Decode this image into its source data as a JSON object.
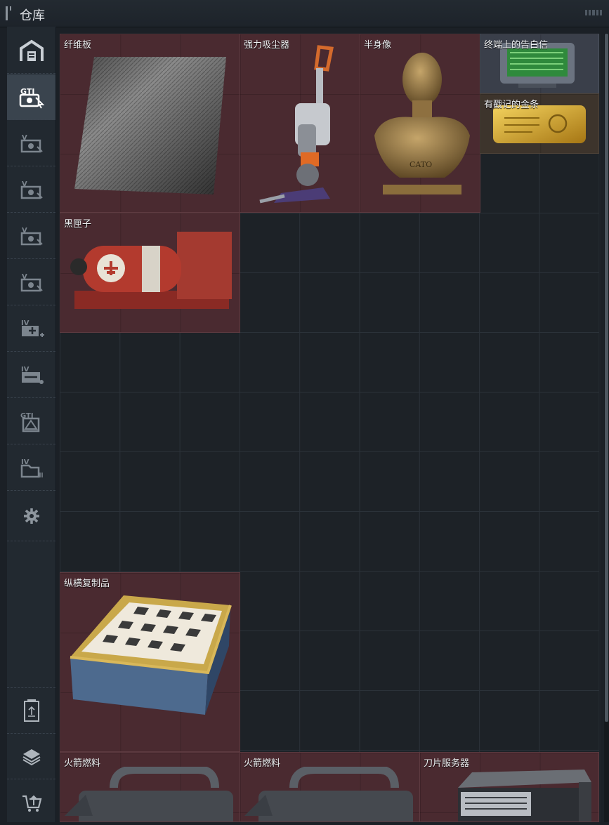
{
  "window": {
    "title": "仓库"
  },
  "sidebar": {
    "items": [
      {
        "icon": "warehouse-icon"
      },
      {
        "icon": "gti-cards-icon",
        "active": true
      },
      {
        "icon": "v-card-icon-1"
      },
      {
        "icon": "v-card-icon-2"
      },
      {
        "icon": "v-card-icon-3"
      },
      {
        "icon": "v-card-icon-4"
      },
      {
        "icon": "iv-add-icon"
      },
      {
        "icon": "iv-minus-icon"
      },
      {
        "icon": "gti-diagram-icon"
      },
      {
        "icon": "iv-folder-icon"
      },
      {
        "icon": "gear-icon"
      },
      {
        "icon": "trash-bin-icon"
      },
      {
        "icon": "layers-icon"
      },
      {
        "icon": "cart-upload-icon"
      }
    ]
  },
  "inventory": {
    "items": [
      {
        "name": "纤维板"
      },
      {
        "name": "强力吸尘器"
      },
      {
        "name": "半身像",
        "engraving": "CATO"
      },
      {
        "name": "终端上的告白信"
      },
      {
        "name": "有戳记的金条"
      },
      {
        "name": "黑匣子"
      },
      {
        "name": "纵横复制品"
      },
      {
        "name": "火箭燃料"
      },
      {
        "name": "火箭燃料"
      },
      {
        "name": "刀片服务器"
      }
    ]
  },
  "colors": {
    "item_bg": "#4a2a30",
    "grid_bg": "#1d2227",
    "sidebar_bg": "#222930",
    "sidebar_active": "#3a444e"
  }
}
